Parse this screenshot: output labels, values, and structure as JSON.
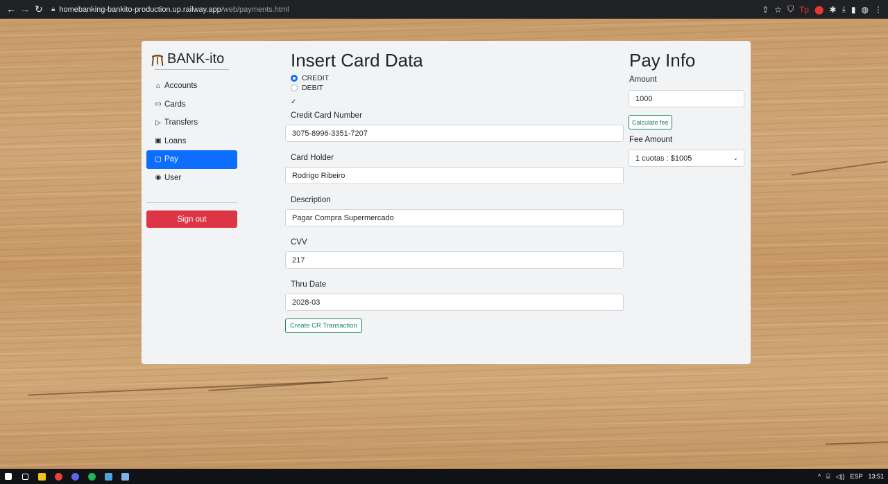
{
  "browser": {
    "url_host": "homebanking-bankito-production.up.railway.app",
    "url_path": "/web/payments.html"
  },
  "sidebar": {
    "brand": "BANK-ito",
    "items": [
      {
        "label": "Accounts",
        "icon": "bank-icon"
      },
      {
        "label": "Cards",
        "icon": "credit-card-icon"
      },
      {
        "label": "Transfers",
        "icon": "transfer-icon"
      },
      {
        "label": "Loans",
        "icon": "cash-icon"
      },
      {
        "label": "Pay",
        "icon": "wallet-icon",
        "active": true
      },
      {
        "label": "User",
        "icon": "person-circle-icon"
      }
    ],
    "signout_label": "Sign out"
  },
  "form": {
    "title": "Insert Card Data",
    "radio_credit": "CREDIT",
    "radio_debit": "DEBIT",
    "selected_type": "CREDIT",
    "check_mark": "✓",
    "card_number_label": "Credit Card Number",
    "card_number_value": "3075-8996-3351-7207",
    "card_holder_label": "Card Holder",
    "card_holder_value": "Rodrigo Ribeiro",
    "description_label": "Description",
    "description_value": "Pagar Compra Supermercado",
    "cvv_label": "CVV",
    "cvv_value": "217",
    "thru_date_label": "Thru Date",
    "thru_date_value": "2028-03",
    "submit_label": "Create CR Transaction"
  },
  "pay_info": {
    "title": "Pay Info",
    "amount_label": "Amount",
    "amount_value": "1000",
    "calculate_label": "Calculate fee",
    "fee_label": "Fee Amount",
    "fee_selected": "1 cuotas : $1005"
  },
  "taskbar": {
    "tray_lang": "ESP",
    "tray_time": "13:51"
  },
  "colors": {
    "primary": "#0d6efd",
    "danger": "#dc3545",
    "success": "#198754",
    "card_bg": "#f1f3f5"
  }
}
